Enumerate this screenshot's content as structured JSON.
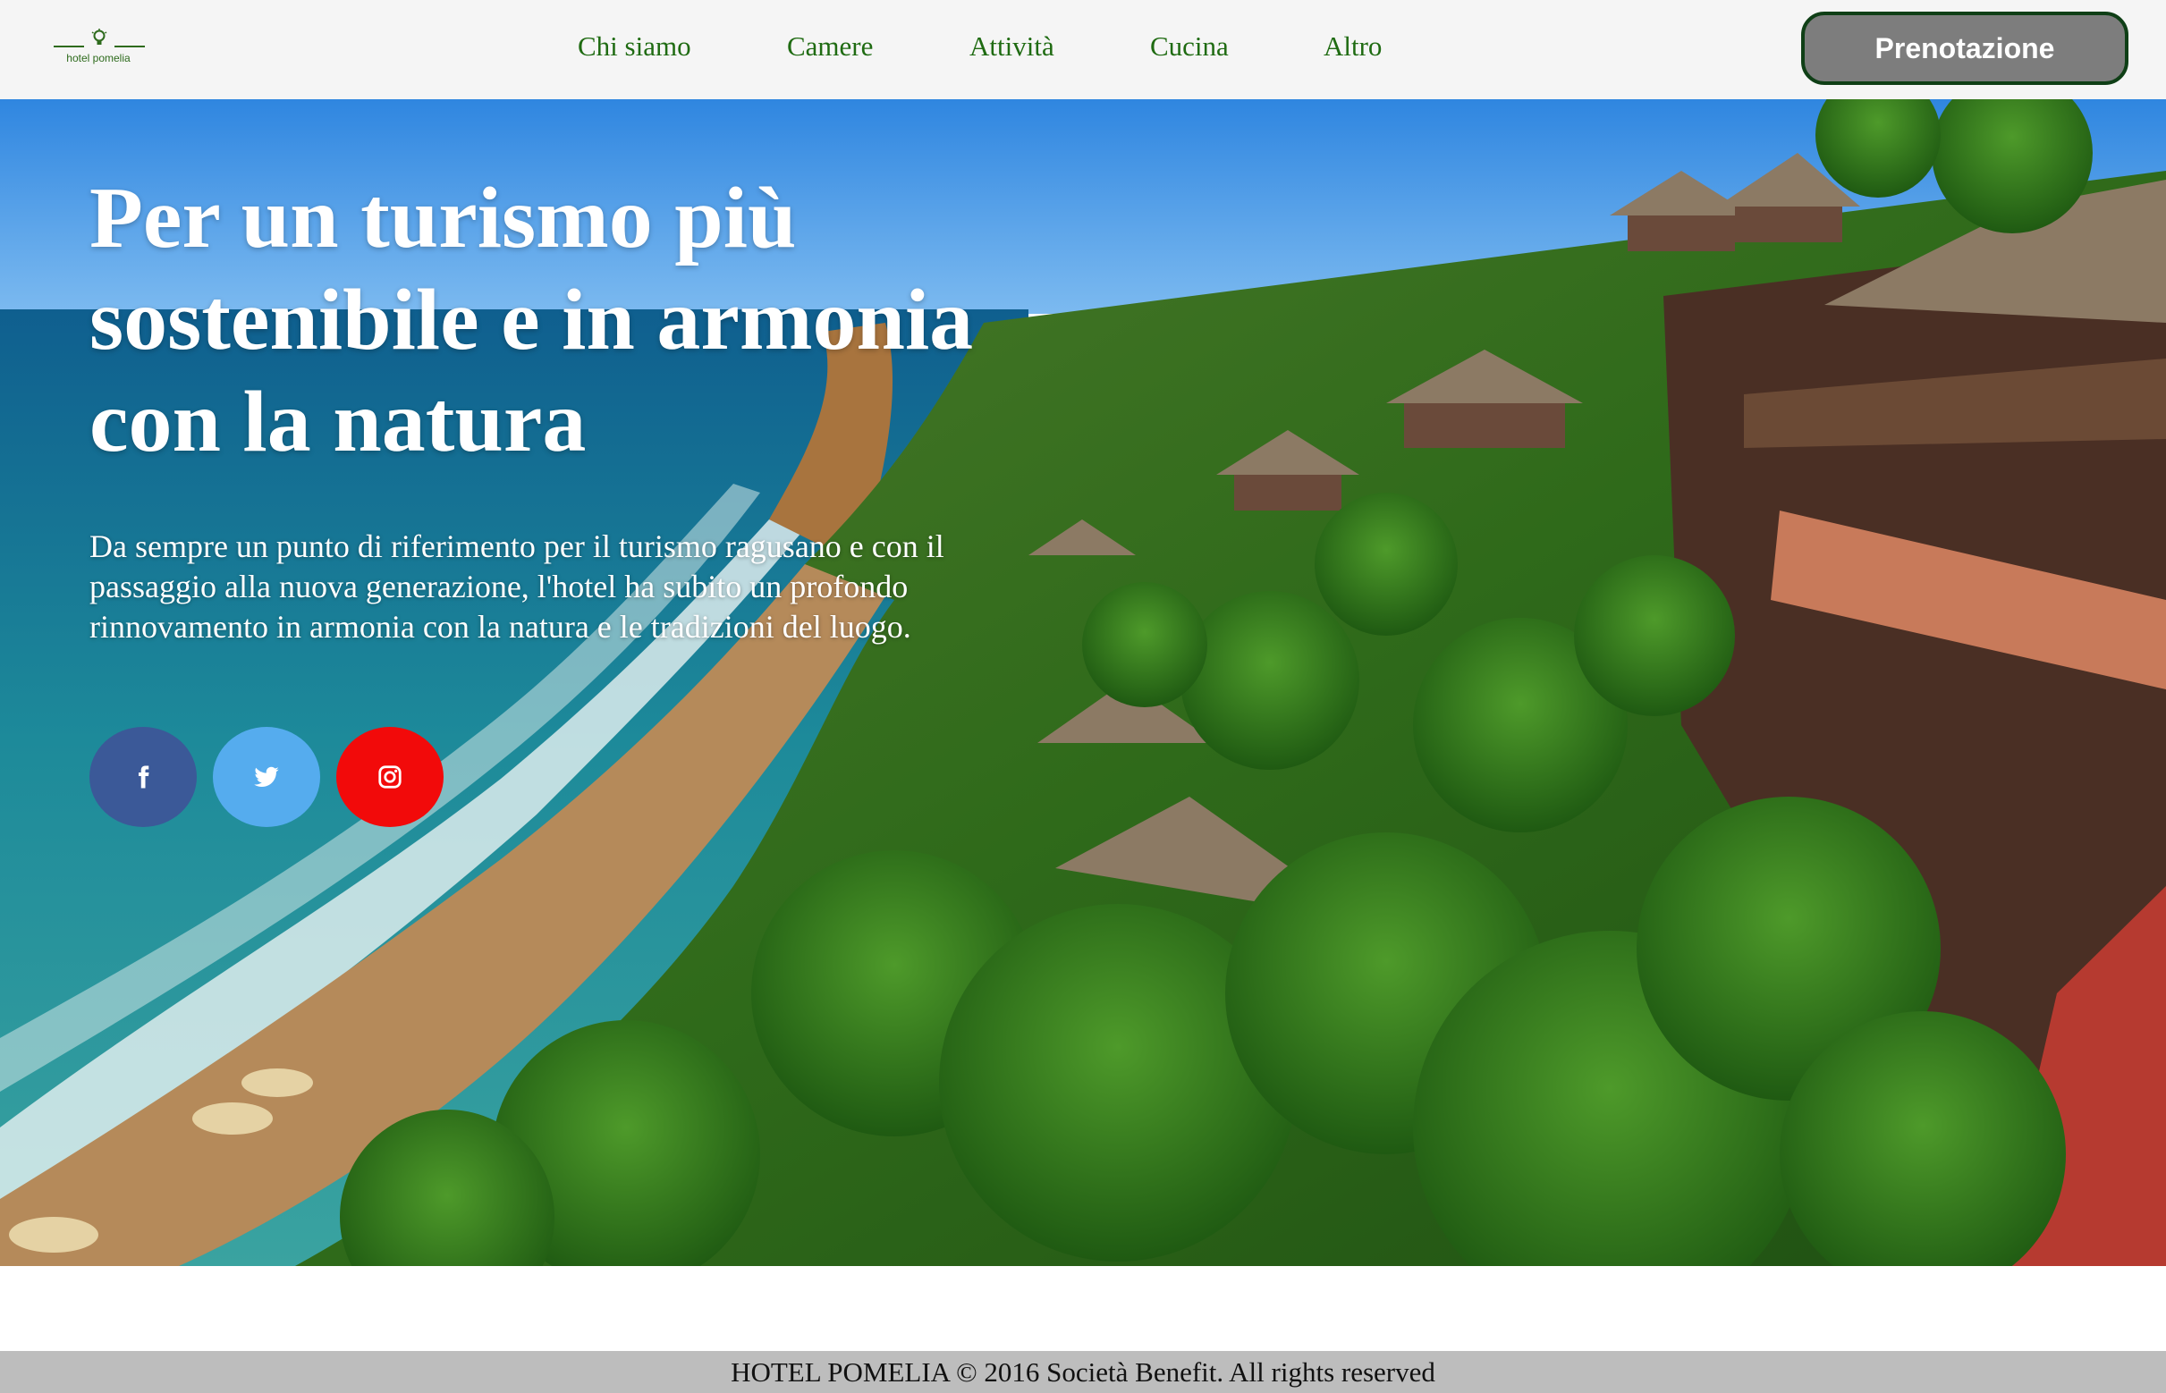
{
  "header": {
    "logo": {
      "text": "hotel pomelia",
      "icon": "lightbulb-icon"
    },
    "nav": [
      {
        "label": "Chi siamo"
      },
      {
        "label": "Camere"
      },
      {
        "label": "Attività"
      },
      {
        "label": "Cucina"
      },
      {
        "label": "Altro"
      }
    ],
    "cta_label": "Prenotazione"
  },
  "hero": {
    "title": "Per un turismo più sostenibile e in armonia con la natura",
    "description": "Da sempre un punto di riferimento per il turismo ragusano e con il passaggio alla nuova generazione, l'hotel ha subito un profondo rinnovamento in armonia con la natura e le tradizioni del luogo.",
    "background_image": "coastal resort with thatched bungalows on a green cliff above the sea",
    "socials": [
      {
        "icon": "facebook-icon",
        "color": "#3b5998"
      },
      {
        "icon": "twitter-icon",
        "color": "#55acee"
      },
      {
        "icon": "instagram-icon",
        "color": "#f20a0a"
      }
    ]
  },
  "footer": {
    "text": "HOTEL POMELIA © 2016 Società Benefit. All rights reserved"
  },
  "colors": {
    "nav_bg": "#f5f5f5",
    "nav_link": "#1f6b12",
    "cta_bg": "#7d7d7d",
    "cta_border": "#0f3f16",
    "footer_bg": "#bdbdbd"
  }
}
